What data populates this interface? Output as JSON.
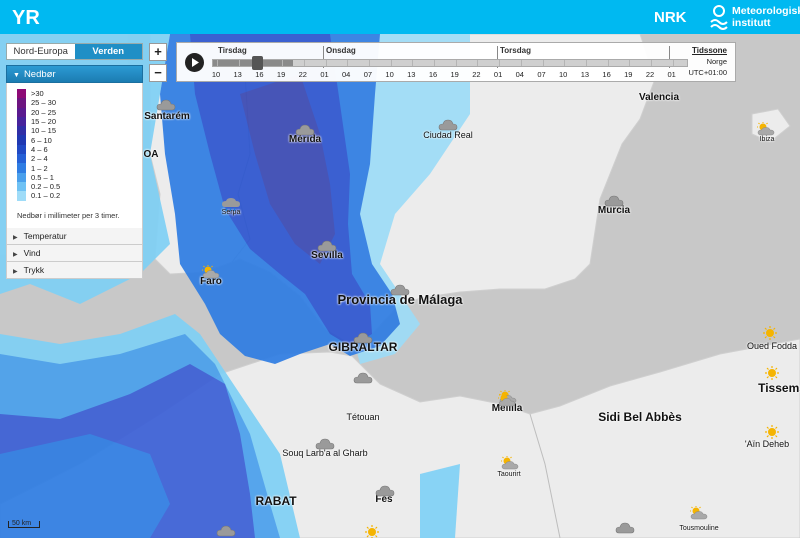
{
  "header": {
    "yr_logo": "YR",
    "nrk_logo": "NRK",
    "met_name_line1": "Meteorologisk",
    "met_name_line2": "institutt"
  },
  "region_tabs": [
    {
      "label": "Nord-Europa",
      "active": false
    },
    {
      "label": "Verden",
      "active": true
    }
  ],
  "layers": {
    "active_label": "Nedbør",
    "legend": [
      {
        "label": ">30",
        "color": "#8d0a76"
      },
      {
        "label": "25 – 30",
        "color": "#6d1580"
      },
      {
        "label": "20 – 25",
        "color": "#5a1a8f"
      },
      {
        "label": "15 – 20",
        "color": "#47239c"
      },
      {
        "label": "10 – 15",
        "color": "#302ea6"
      },
      {
        "label": "6 – 10",
        "color": "#1f38b2"
      },
      {
        "label": "4 – 6",
        "color": "#2049c4"
      },
      {
        "label": "2 – 4",
        "color": "#2560d6"
      },
      {
        "label": "1 – 2",
        "color": "#2f7de3"
      },
      {
        "label": "0.5 – 1",
        "color": "#4aa0ec"
      },
      {
        "label": "0.2 – 0.5",
        "color": "#6fc2f4"
      },
      {
        "label": "0.1 – 0.2",
        "color": "#9fdcf8"
      }
    ],
    "legend_note": "Nedbør i millimeter per 3 timer.",
    "other": [
      {
        "label": "Temperatur"
      },
      {
        "label": "Vind"
      },
      {
        "label": "Trykk"
      }
    ]
  },
  "zoom": {
    "in_label": "+",
    "out_label": "−"
  },
  "timeline": {
    "days": [
      "Tirsdag",
      "Onsdag",
      "Torsdag"
    ],
    "hours": [
      "10",
      "13",
      "16",
      "19",
      "22",
      "01",
      "04",
      "07",
      "10",
      "13",
      "16",
      "19",
      "22",
      "01",
      "04",
      "07",
      "10",
      "13",
      "16",
      "19",
      "22",
      "01"
    ],
    "selected_hour": "16",
    "timezone_title": "Tidssone",
    "timezone_region": "Norge",
    "timezone_offset": "UTC+01:00"
  },
  "places": [
    {
      "name": "Valencia",
      "cls": "med"
    },
    {
      "name": "Santarém",
      "cls": "med"
    },
    {
      "name": "OA",
      "cls": "med"
    },
    {
      "name": "Mérida",
      "cls": "med"
    },
    {
      "name": "Ciudad Real",
      "cls": "small"
    },
    {
      "name": "Ibiza",
      "cls": "xsmall"
    },
    {
      "name": "Serpa",
      "cls": "xsmall"
    },
    {
      "name": "Murcia",
      "cls": "med"
    },
    {
      "name": "Sevilla",
      "cls": "med"
    },
    {
      "name": "Faro",
      "cls": "med"
    },
    {
      "name": "Provincia de Málaga",
      "cls": "region"
    },
    {
      "name": "GIBRALTAR",
      "cls": "big"
    },
    {
      "name": "Tétouan",
      "cls": "small"
    },
    {
      "name": "Melilla",
      "cls": "med"
    },
    {
      "name": "Oued Fodda",
      "cls": "small"
    },
    {
      "name": "Tissems",
      "cls": "big"
    },
    {
      "name": "Sidi Bel Abbès",
      "cls": "big"
    },
    {
      "name": "'Aïn Deheb",
      "cls": "small"
    },
    {
      "name": "Souq Larb'a al Gharb",
      "cls": "small"
    },
    {
      "name": "Taourirt",
      "cls": "xsmall"
    },
    {
      "name": "RABAT",
      "cls": "big"
    },
    {
      "name": "Fès",
      "cls": "med"
    },
    {
      "name": "Tousmouline",
      "cls": "xsmall"
    }
  ],
  "weather_icons": [
    {
      "type": "cloud"
    },
    {
      "type": "cloud"
    },
    {
      "type": "cloud"
    },
    {
      "type": "sun-cloud"
    },
    {
      "type": "rain"
    },
    {
      "type": "cloud"
    },
    {
      "type": "cloud"
    },
    {
      "type": "sun-cloud"
    },
    {
      "type": "cloud"
    },
    {
      "type": "cloud"
    },
    {
      "type": "cloud"
    },
    {
      "type": "sun-cloud"
    },
    {
      "type": "sun"
    },
    {
      "type": "sun"
    },
    {
      "type": "sun-cloud"
    },
    {
      "type": "sun"
    },
    {
      "type": "cloud"
    },
    {
      "type": "sun-cloud"
    },
    {
      "type": "cloud"
    },
    {
      "type": "cloud"
    },
    {
      "type": "sun"
    },
    {
      "type": "sun-cloud"
    },
    {
      "type": "cloud"
    }
  ],
  "scale_label": "50 km"
}
